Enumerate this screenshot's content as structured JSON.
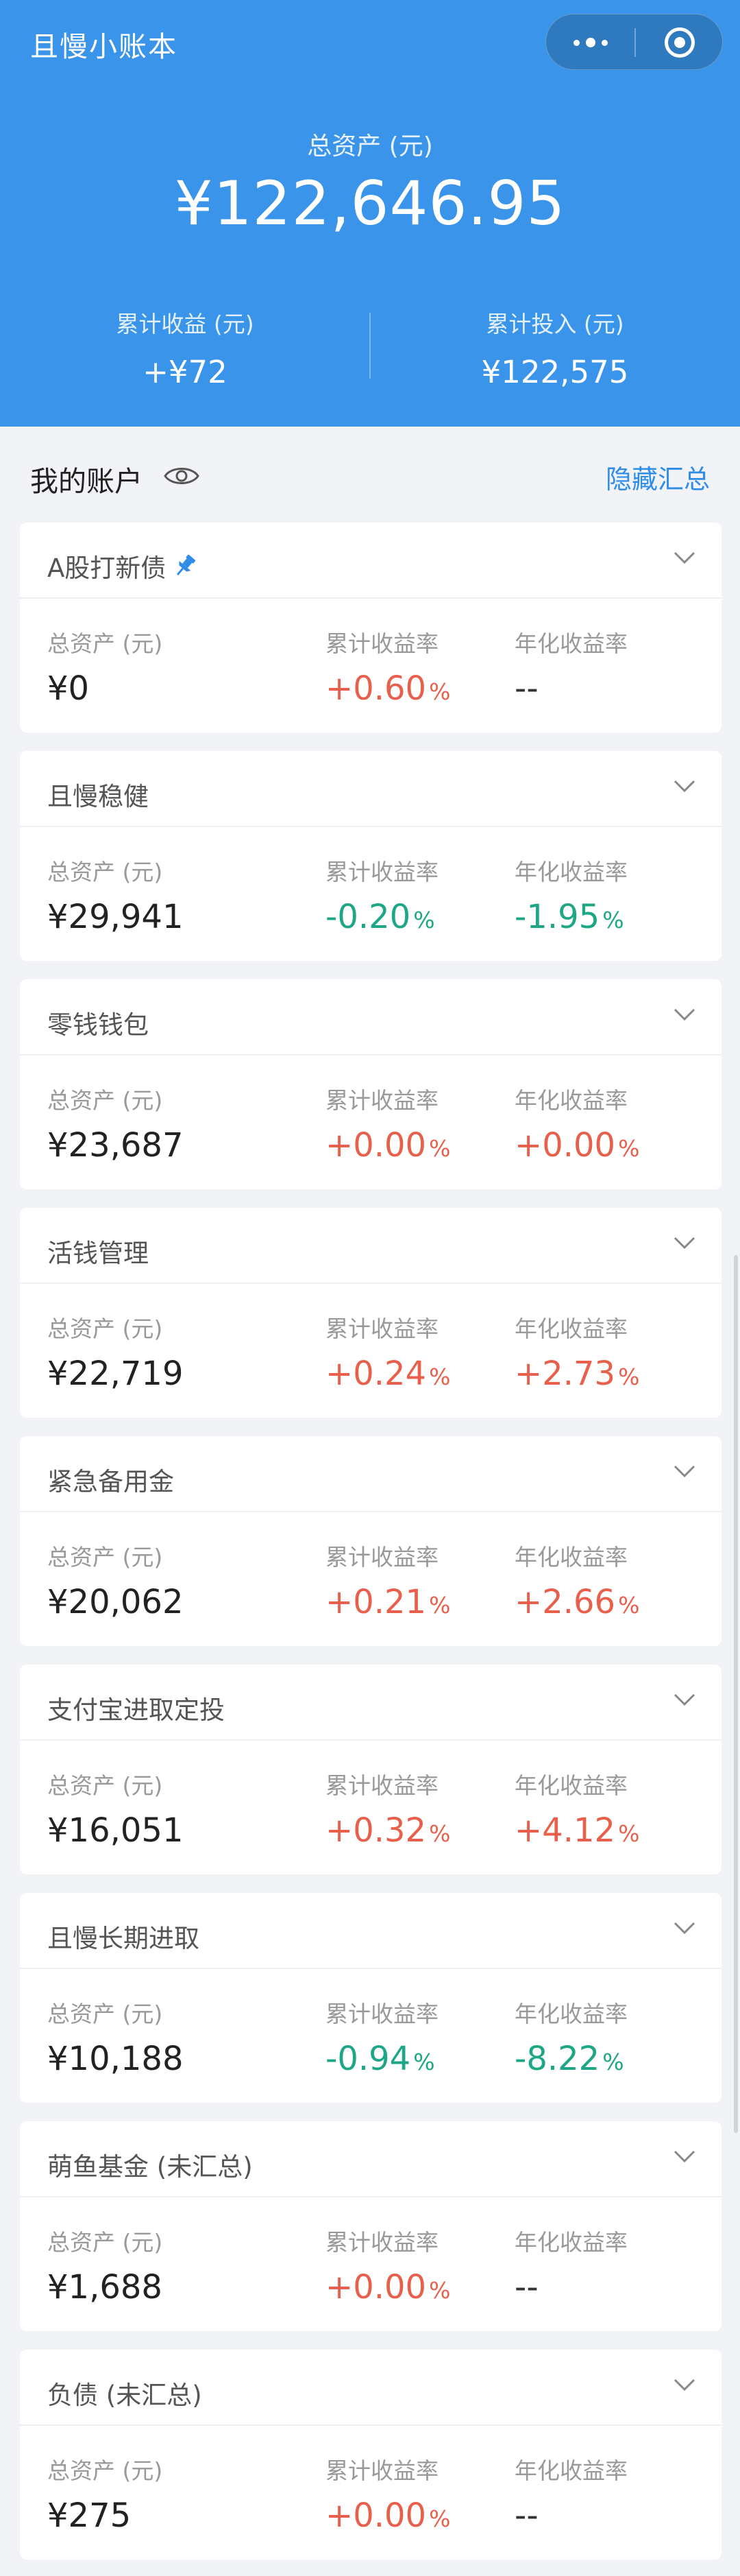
{
  "app": {
    "title": "且慢小账本"
  },
  "summary": {
    "total_label": "总资产 (元)",
    "total_value": "¥122,646.95",
    "profit_label": "累计收益 (元)",
    "profit_value": "+¥72",
    "invest_label": "累计投入 (元)",
    "invest_value": "¥122,575"
  },
  "section": {
    "title": "我的账户",
    "hide_label": "隐藏汇总"
  },
  "labels": {
    "assets": "总资产 (元)",
    "cum_rate": "累计收益率",
    "annual_rate": "年化收益率"
  },
  "accounts": [
    {
      "name": "A股打新债",
      "assets": "¥0",
      "cum_rate": "+0.60",
      "cum_unit": "%",
      "annual_rate": "--",
      "annual_unit": "",
      "pinned": true
    },
    {
      "name": "且慢稳健",
      "assets": "¥29,941",
      "cum_rate": "-0.20",
      "cum_unit": "%",
      "annual_rate": "-1.95",
      "annual_unit": "%"
    },
    {
      "name": "零钱钱包",
      "assets": "¥23,687",
      "cum_rate": "+0.00",
      "cum_unit": "%",
      "annual_rate": "+0.00",
      "annual_unit": "%"
    },
    {
      "name": "活钱管理",
      "assets": "¥22,719",
      "cum_rate": "+0.24",
      "cum_unit": "%",
      "annual_rate": "+2.73",
      "annual_unit": "%"
    },
    {
      "name": "紧急备用金",
      "assets": "¥20,062",
      "cum_rate": "+0.21",
      "cum_unit": "%",
      "annual_rate": "+2.66",
      "annual_unit": "%"
    },
    {
      "name": "支付宝进取定投",
      "assets": "¥16,051",
      "cum_rate": "+0.32",
      "cum_unit": "%",
      "annual_rate": "+4.12",
      "annual_unit": "%"
    },
    {
      "name": "且慢长期进取",
      "assets": "¥10,188",
      "cum_rate": "-0.94",
      "cum_unit": "%",
      "annual_rate": "-8.22",
      "annual_unit": "%"
    },
    {
      "name": "萌鱼基金 (未汇总)",
      "assets": "¥1,688",
      "cum_rate": "+0.00",
      "cum_unit": "%",
      "annual_rate": "--",
      "annual_unit": ""
    },
    {
      "name": "负债 (未汇总)",
      "assets": "¥275",
      "cum_rate": "+0.00",
      "cum_unit": "%",
      "annual_rate": "--",
      "annual_unit": ""
    }
  ],
  "colors": {
    "primary": "#3a95ea",
    "positive": "#e8604c",
    "negative": "#1ea786",
    "link": "#2f8de8"
  }
}
